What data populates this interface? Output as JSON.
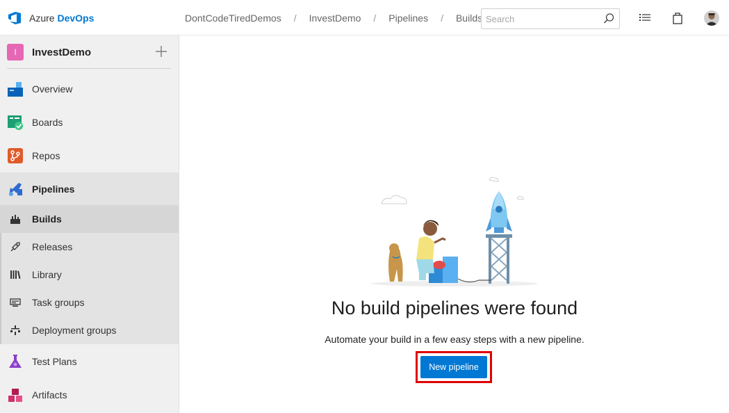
{
  "header": {
    "brand_prefix": "Azure",
    "brand_suffix": "DevOps",
    "breadcrumbs": [
      "DontCodeTiredDemos",
      "InvestDemo",
      "Pipelines",
      "Builds"
    ],
    "separator": "/",
    "search": {
      "placeholder": "Search",
      "value": ""
    }
  },
  "sidebar": {
    "project": {
      "badge": "I",
      "name": "InvestDemo"
    },
    "items": [
      {
        "label": "Overview",
        "icon": "overview-icon"
      },
      {
        "label": "Boards",
        "icon": "boards-icon"
      },
      {
        "label": "Repos",
        "icon": "repos-icon"
      },
      {
        "label": "Pipelines",
        "icon": "pipelines-icon",
        "active": true
      },
      {
        "label": "Test Plans",
        "icon": "test-plans-icon"
      },
      {
        "label": "Artifacts",
        "icon": "artifacts-icon"
      }
    ],
    "pipelines_sub": [
      {
        "label": "Builds",
        "icon": "builds-icon",
        "selected": true
      },
      {
        "label": "Releases",
        "icon": "releases-icon"
      },
      {
        "label": "Library",
        "icon": "library-icon"
      },
      {
        "label": "Task groups",
        "icon": "task-groups-icon"
      },
      {
        "label": "Deployment groups",
        "icon": "deployment-groups-icon"
      }
    ]
  },
  "main": {
    "empty_title": "No build pipelines were found",
    "empty_description": "Automate your build in a few easy steps with a new pipeline.",
    "new_pipeline_label": "New pipeline"
  },
  "colors": {
    "accent": "#0078d4",
    "highlight": "#e00000",
    "project_badge": "#e667b4"
  }
}
